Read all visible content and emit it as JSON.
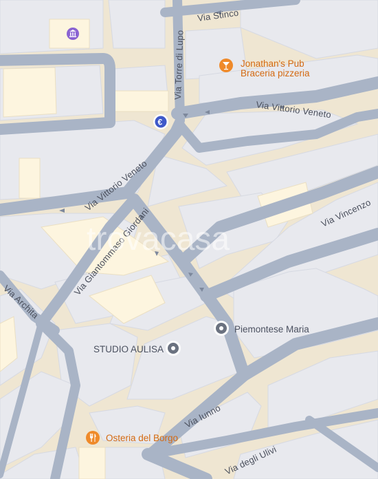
{
  "watermark": "trovacasa",
  "colors": {
    "block": "#e8e9ee",
    "block_edge": "#d9dbe3",
    "land": "#f3e7cf",
    "highlight": "#fdf5df",
    "road": "#a9b4c6",
    "road_edge": "#8f9bb0",
    "poi_orange": "#e8892a",
    "poi_grey": "#6b7280",
    "poi_purple": "#7b5fd9"
  },
  "streets": {
    "via_stinco": "Via Stinco",
    "via_torre_di_lupo": "Via Torre di Lupo",
    "via_vittorio_veneto_east": "Via Vittorio Veneto",
    "via_vittorio_veneto_west": "Via Vittorio Veneto",
    "via_giantommaso_giordani": "Via Giantommaso Giordani",
    "via_vincenzo": "Via Vincenzo",
    "via_archita": "Via Archita",
    "via_iunno": "Via Iunno",
    "via_degli_ulivi": "Via degli Ulivi"
  },
  "pois": {
    "jonathans_pub": {
      "name": "Jonathan's Pub",
      "subtitle": "Braceria pizzeria",
      "icon": "cocktail-icon"
    },
    "piemontese_maria": {
      "name": "Piemontese Maria",
      "icon": "place-pin-icon"
    },
    "studio_aulisa": {
      "name": "STUDIO AULISA",
      "icon": "place-pin-icon"
    },
    "osteria_del_borgo": {
      "name": "Osteria del Borgo",
      "icon": "restaurant-icon"
    },
    "museum": {
      "icon": "museum-icon"
    },
    "atm": {
      "icon": "euro-icon"
    }
  }
}
